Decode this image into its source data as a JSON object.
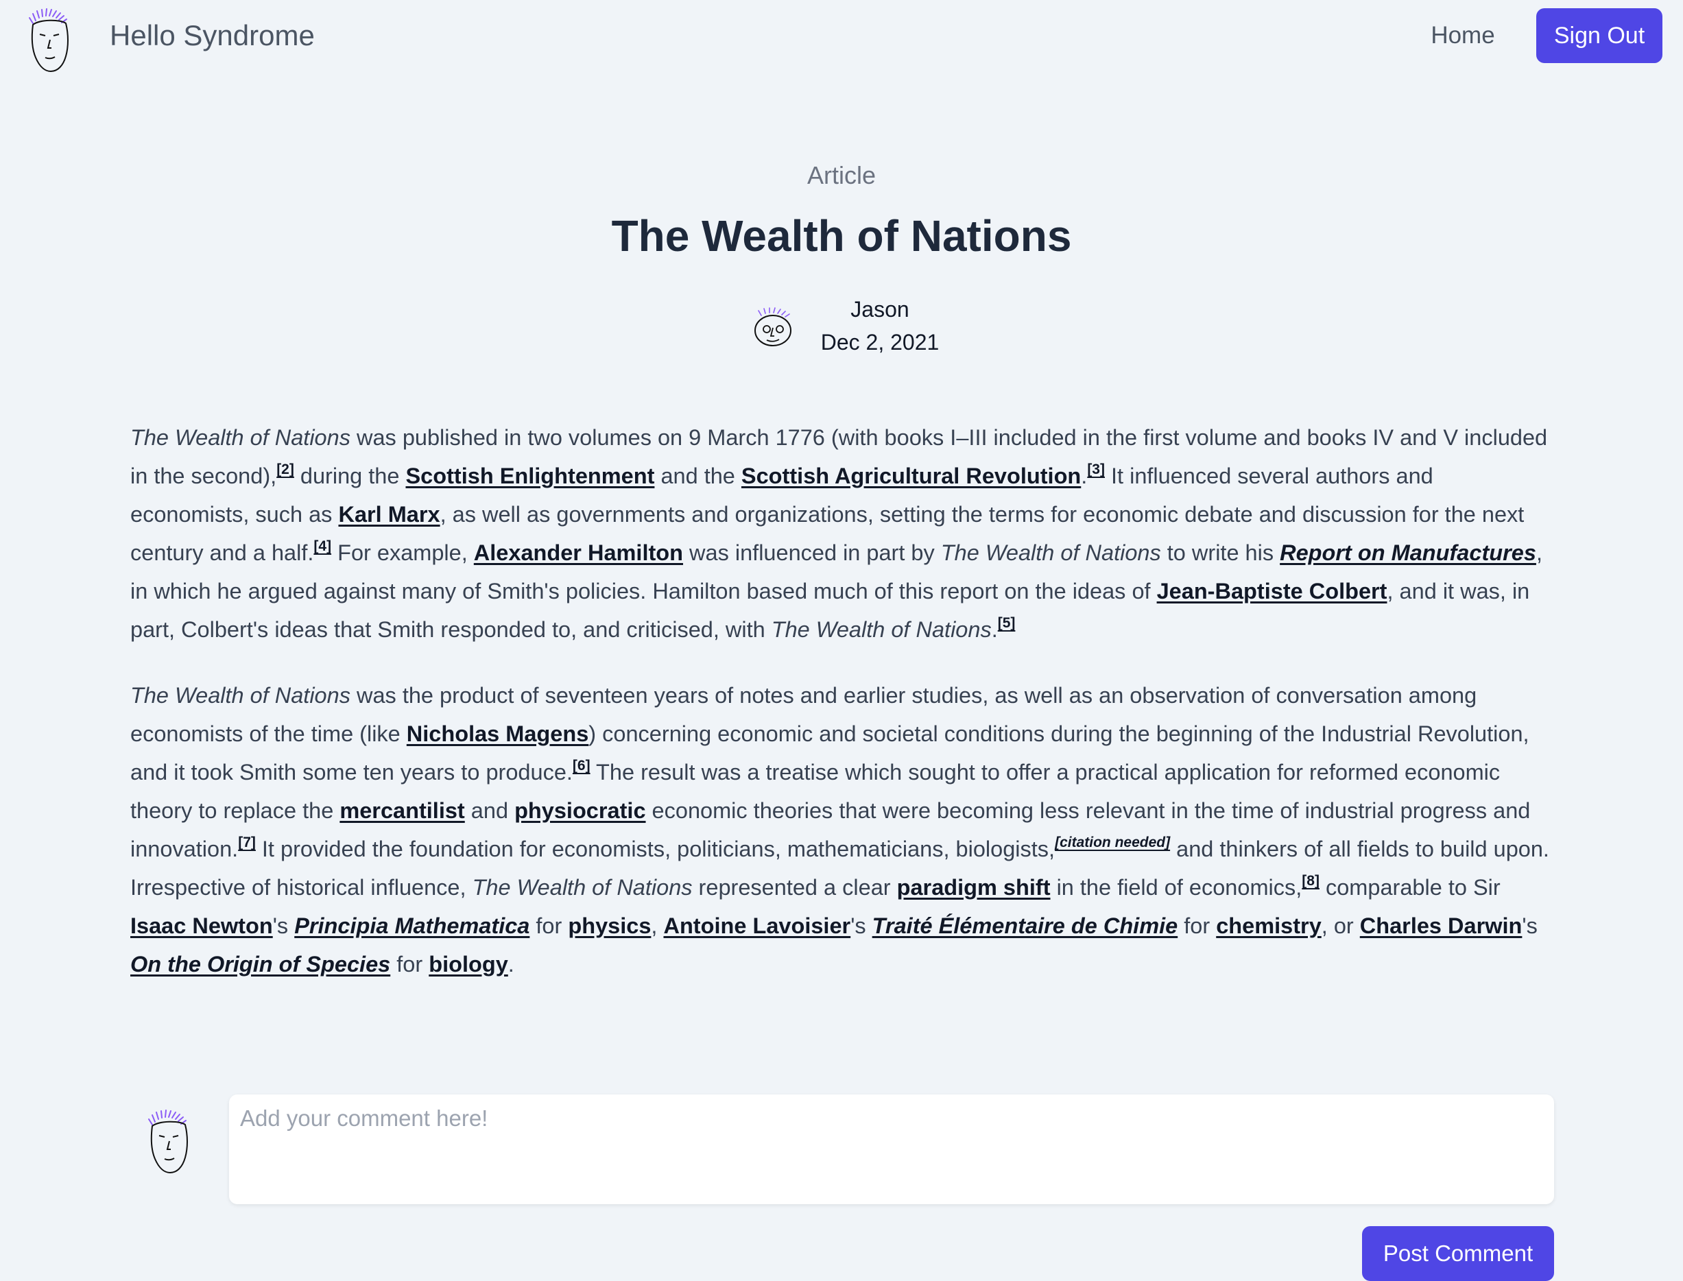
{
  "header": {
    "site_name": "Hello Syndrome",
    "nav_home": "Home",
    "sign_out": "Sign Out",
    "logo_icon": "face-avatar-icon"
  },
  "article": {
    "kicker": "Article",
    "title": "The Wealth of Nations",
    "author": "Jason",
    "date": "Dec 2, 2021",
    "paragraphs": [
      [
        {
          "t": "The Wealth of Nations",
          "s": "i"
        },
        {
          "t": " was published in two volumes on 9 March 1776 (with books I–III included in the first volume and books IV and V included in the second),"
        },
        {
          "t": "[2]",
          "s": "ref"
        },
        {
          "t": " during the "
        },
        {
          "t": "Scottish Enlightenment",
          "s": "link"
        },
        {
          "t": " and the "
        },
        {
          "t": "Scottish Agricultural Revolution",
          "s": "link"
        },
        {
          "t": "."
        },
        {
          "t": "[3]",
          "s": "ref"
        },
        {
          "t": " It influenced several authors and economists, such as "
        },
        {
          "t": "Karl Marx",
          "s": "link"
        },
        {
          "t": ", as well as governments and organizations, setting the terms for economic debate and discussion for the next century and a half."
        },
        {
          "t": "[4]",
          "s": "ref"
        },
        {
          "t": " For example, "
        },
        {
          "t": "Alexander Hamilton",
          "s": "link"
        },
        {
          "t": " was influenced in part by "
        },
        {
          "t": "The Wealth of Nations",
          "s": "i"
        },
        {
          "t": " to write his "
        },
        {
          "t": "Report on Manufactures",
          "s": "ilink"
        },
        {
          "t": ", in which he argued against many of Smith's policies. Hamilton based much of this report on the ideas of "
        },
        {
          "t": "Jean-Baptiste Colbert",
          "s": "link"
        },
        {
          "t": ", and it was, in part, Colbert's ideas that Smith responded to, and criticised, with "
        },
        {
          "t": "The Wealth of Nations",
          "s": "i"
        },
        {
          "t": "."
        },
        {
          "t": "[5]",
          "s": "ref"
        }
      ],
      [
        {
          "t": "The Wealth of Nations",
          "s": "i"
        },
        {
          "t": " was the product of seventeen years of notes and earlier studies, as well as an observation of conversation among economists of the time (like "
        },
        {
          "t": "Nicholas Magens",
          "s": "link"
        },
        {
          "t": ") concerning economic and societal conditions during the beginning of the Industrial Revolution, and it took Smith some ten years to produce."
        },
        {
          "t": "[6]",
          "s": "ref"
        },
        {
          "t": " The result was a treatise which sought to offer a practical application for reformed economic theory to replace the "
        },
        {
          "t": "mercantilist",
          "s": "link"
        },
        {
          "t": " and "
        },
        {
          "t": "physiocratic",
          "s": "link"
        },
        {
          "t": " economic theories that were becoming less relevant in the time of industrial progress and innovation."
        },
        {
          "t": "[7]",
          "s": "ref"
        },
        {
          "t": " It provided the foundation for economists, politicians, mathematicians, biologists,"
        },
        {
          "t": "[citation needed]",
          "s": "cn"
        },
        {
          "t": " and thinkers of all fields to build upon. Irrespective of historical influence, "
        },
        {
          "t": "The Wealth of Nations",
          "s": "i"
        },
        {
          "t": " represented a clear "
        },
        {
          "t": "paradigm shift",
          "s": "link"
        },
        {
          "t": " in the field of economics,"
        },
        {
          "t": "[8]",
          "s": "ref"
        },
        {
          "t": " comparable to Sir "
        },
        {
          "t": "Isaac Newton",
          "s": "link"
        },
        {
          "t": "'s "
        },
        {
          "t": "Principia Mathematica",
          "s": "ilink"
        },
        {
          "t": " for "
        },
        {
          "t": "physics",
          "s": "link"
        },
        {
          "t": ", "
        },
        {
          "t": "Antoine Lavoisier",
          "s": "link"
        },
        {
          "t": "'s "
        },
        {
          "t": "Traité Élémentaire de Chimie",
          "s": "ilink"
        },
        {
          "t": " for "
        },
        {
          "t": "chemistry",
          "s": "link"
        },
        {
          "t": ", or "
        },
        {
          "t": "Charles Darwin",
          "s": "link"
        },
        {
          "t": "'s "
        },
        {
          "t": "On the Origin of Species",
          "s": "ilink"
        },
        {
          "t": " for "
        },
        {
          "t": "biology",
          "s": "link"
        },
        {
          "t": "."
        }
      ]
    ]
  },
  "comment": {
    "placeholder": "Add your comment here!",
    "value": "",
    "post_label": "Post Comment"
  },
  "colors": {
    "accent": "#4f46e5",
    "page_bg": "#f0f4f8",
    "avatar_hair": "#8b5cf6"
  }
}
